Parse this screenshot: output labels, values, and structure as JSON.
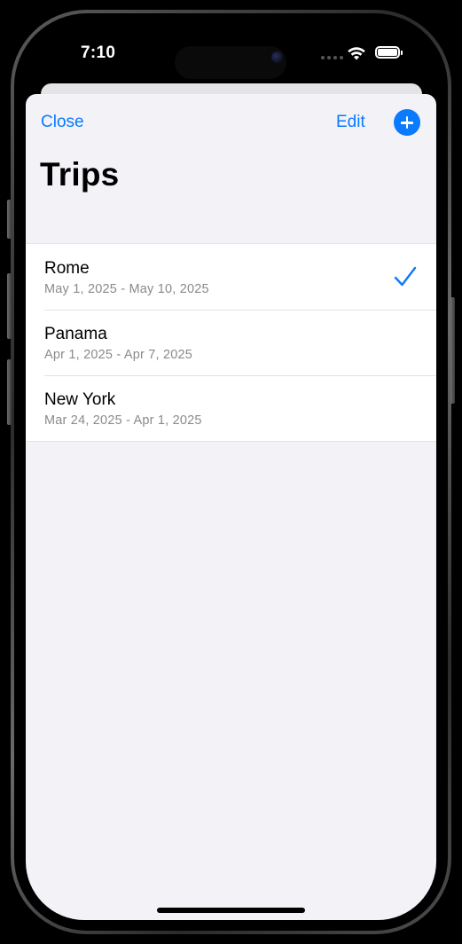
{
  "status_bar": {
    "time": "7:10",
    "icons": [
      "cellular-signal-icon",
      "wifi-icon",
      "battery-icon"
    ]
  },
  "nav": {
    "close_label": "Close",
    "edit_label": "Edit",
    "add_icon": "plus-circle-icon",
    "title": "Trips"
  },
  "trips": [
    {
      "name": "Rome",
      "dates": "May 1, 2025 - May 10, 2025",
      "selected": true
    },
    {
      "name": "Panama",
      "dates": "Apr 1, 2025 - Apr 7, 2025",
      "selected": false
    },
    {
      "name": "New York",
      "dates": "Mar 24, 2025 - Apr 1, 2025",
      "selected": false
    }
  ],
  "colors": {
    "accent": "#0a7aff",
    "background": "#f2f2f7",
    "secondary_text": "#8a8a8e"
  }
}
